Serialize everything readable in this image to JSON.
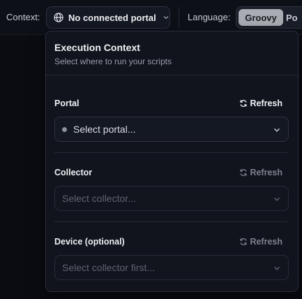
{
  "toolbar": {
    "context_label": "Context:",
    "portal_button_label": "No connected portal",
    "language_label": "Language:",
    "languages": [
      "Groovy",
      "Po"
    ]
  },
  "panel": {
    "title": "Execution Context",
    "subtitle": "Select where to run your scripts",
    "sections": [
      {
        "label": "Portal",
        "refresh": "Refresh",
        "placeholder": "Select portal..."
      },
      {
        "label": "Collector",
        "refresh": "Refresh",
        "placeholder": "Select collector..."
      },
      {
        "label": "Device (optional)",
        "refresh": "Refresh",
        "placeholder": "Select collector first..."
      }
    ]
  },
  "icons": {
    "globe": "globe-icon",
    "chevron": "chevron-down-icon",
    "refresh": "refresh-icon"
  },
  "colors": {
    "background": "#0a0c12",
    "panel": "#11141c",
    "active_language_bg": "#a9acb3"
  }
}
